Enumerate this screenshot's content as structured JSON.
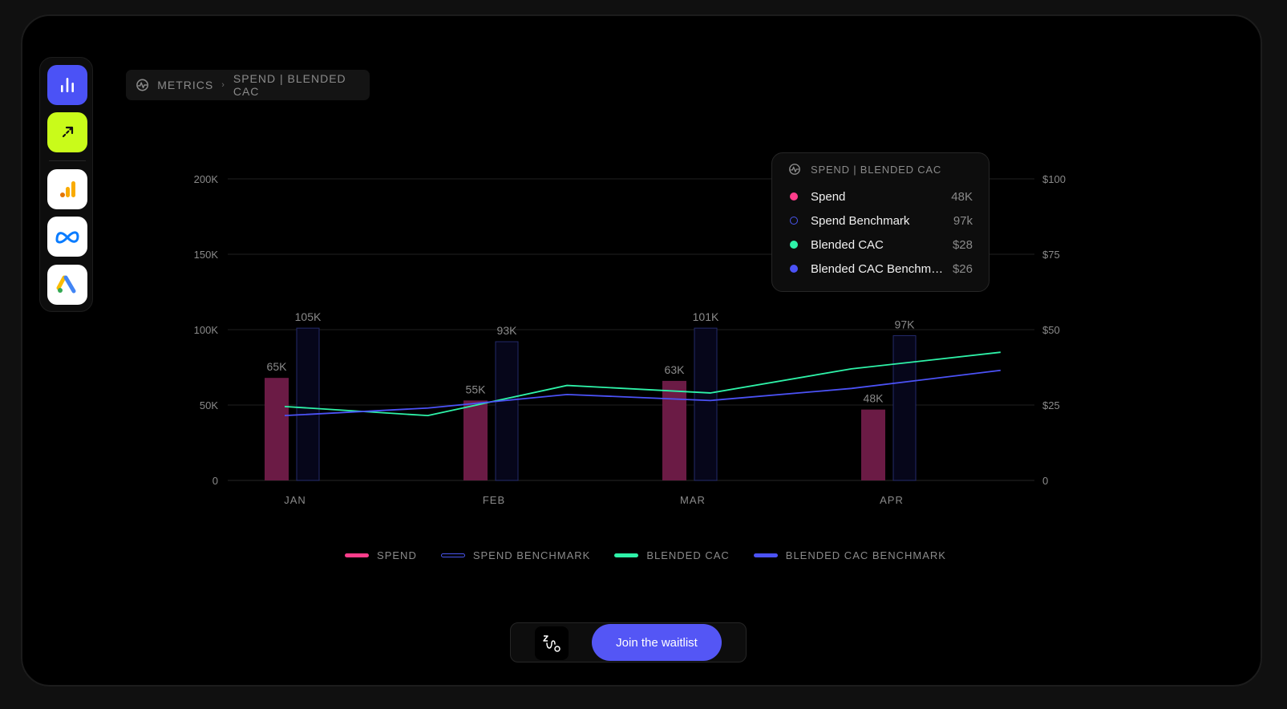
{
  "breadcrumb": {
    "root": "METRICS",
    "page": "SPEND | BLENDED CAC"
  },
  "sidebar": {
    "items": [
      {
        "name": "metrics-nav",
        "icon": "bar-chart-icon",
        "color": "#4b52f6"
      },
      {
        "name": "expand-nav",
        "icon": "arrow-up-right-icon",
        "color": "#c9fb1a"
      },
      {
        "name": "google-analytics-nav",
        "icon": "google-analytics-icon",
        "color": "#ffffff"
      },
      {
        "name": "meta-nav",
        "icon": "meta-icon",
        "color": "#ffffff"
      },
      {
        "name": "google-ads-nav",
        "icon": "google-ads-icon",
        "color": "#ffffff"
      }
    ]
  },
  "chart_data": {
    "type": "bar",
    "categories": [
      "JAN",
      "FEB",
      "MAR",
      "APR"
    ],
    "left_axis": {
      "ticks": [
        "0",
        "50K",
        "100K",
        "150K",
        "200K"
      ],
      "ylim": [
        0,
        200000
      ]
    },
    "right_axis": {
      "ticks": [
        "0",
        "$25",
        "$50",
        "$75",
        "$100"
      ],
      "ylim": [
        0,
        100
      ]
    },
    "series": [
      {
        "name": "SPEND",
        "kind": "bar",
        "axis": "left",
        "values": [
          68000,
          53000,
          66000,
          47000
        ],
        "labels": [
          "65K",
          "55K",
          "63K",
          "48K"
        ],
        "color": "#ff3d8b"
      },
      {
        "name": "SPEND BENCHMARK",
        "kind": "bar-outline",
        "axis": "left",
        "values": [
          101000,
          92000,
          101000,
          96000
        ],
        "labels": [
          "105K",
          "93K",
          "101K",
          "97K"
        ],
        "color": "#4a56f0"
      },
      {
        "name": "BLENDED CAC",
        "kind": "line",
        "axis": "right",
        "x": [
          0,
          0.72,
          1.42,
          2.14,
          2.85,
          3.6
        ],
        "values": [
          24.5,
          21.5,
          31.5,
          29,
          37,
          42.5
        ],
        "color": "#2ef2a8"
      },
      {
        "name": "BLENDED CAC BENCHMARK",
        "kind": "line",
        "axis": "right",
        "x": [
          0,
          0.72,
          1.42,
          2.14,
          2.85,
          3.6
        ],
        "values": [
          21.5,
          24,
          28.5,
          26.5,
          30.5,
          36.5
        ],
        "color": "#4b52f6"
      }
    ],
    "grid": true,
    "legend": "bottom"
  },
  "tooltip": {
    "title": "SPEND | BLENDED CAC",
    "rows": [
      {
        "label": "Spend",
        "value": "48K",
        "color": "#ff3d8b",
        "hollow": false
      },
      {
        "label": "Spend Benchmark",
        "value": "97k",
        "color": "#4a56f0",
        "hollow": true
      },
      {
        "label": "Blended CAC",
        "value": "$28",
        "color": "#2ef2a8",
        "hollow": false
      },
      {
        "label": "Blended CAC Benchmark",
        "value": "$26",
        "color": "#4b52f6",
        "hollow": false
      }
    ]
  },
  "legend": [
    {
      "label": "SPEND",
      "color": "#ff3d8b",
      "hollow": false
    },
    {
      "label": "SPEND BENCHMARK",
      "color": "#4a56f0",
      "hollow": true
    },
    {
      "label": "BLENDED CAC",
      "color": "#2ef2a8",
      "hollow": false
    },
    {
      "label": "BLENDED CAC BENCHMARK",
      "color": "#4b52f6",
      "hollow": false
    }
  ],
  "cta": {
    "logo_icon": "brand-logo-icon",
    "button_label": "Join the waitlist"
  }
}
